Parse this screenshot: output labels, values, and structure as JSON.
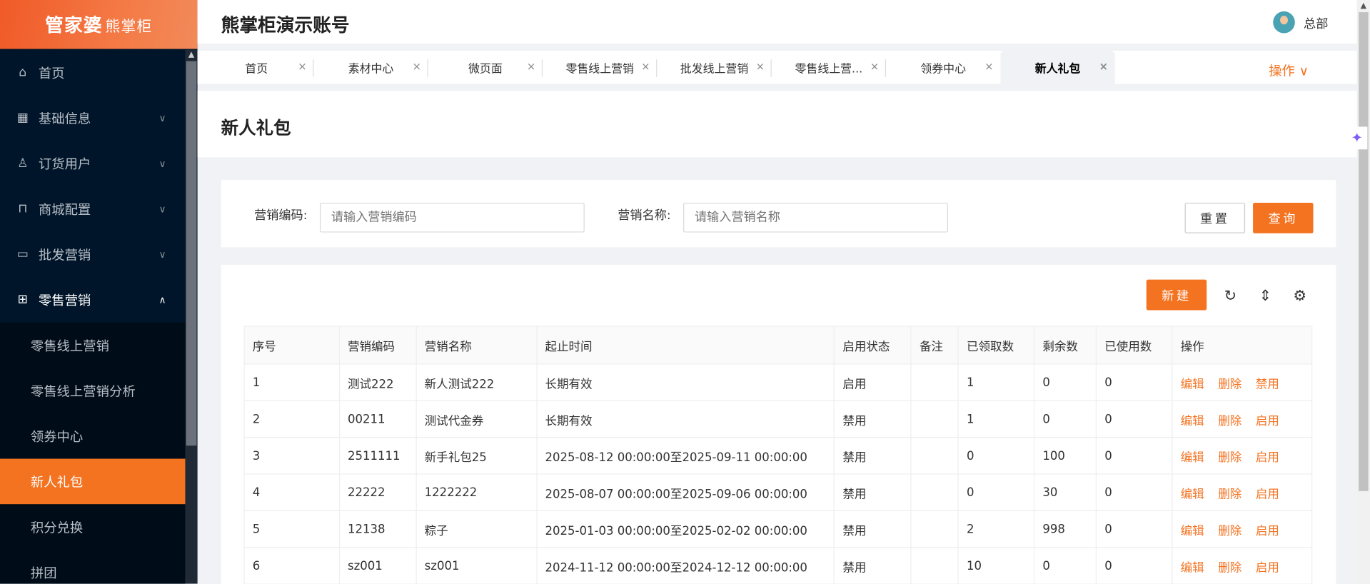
{
  "logo": {
    "brand": "管家婆",
    "sub": "熊掌柜"
  },
  "sidebar": {
    "items": [
      {
        "label": "首页",
        "icon": "home-icon",
        "glyph": "⌂"
      },
      {
        "label": "基础信息",
        "icon": "grid-icon",
        "glyph": "▦",
        "chev": "∨"
      },
      {
        "label": "订货用户",
        "icon": "users-icon",
        "glyph": "♙",
        "chev": "∨"
      },
      {
        "label": "商城配置",
        "icon": "bag-icon",
        "glyph": "⊓",
        "chev": "∨"
      },
      {
        "label": "批发营销",
        "icon": "card-icon",
        "glyph": "▭",
        "chev": "∨"
      },
      {
        "label": "零售营销",
        "icon": "gift-icon",
        "glyph": "⊞",
        "chev": "∧"
      }
    ],
    "sub": [
      "零售线上营销",
      "零售线上营销分析",
      "领券中心",
      "新人礼包",
      "积分兑换",
      "拼团"
    ]
  },
  "header": {
    "title": "熊掌柜演示账号",
    "user": "总部"
  },
  "tabs": [
    "首页",
    "素材中心",
    "微页面",
    "零售线上营销",
    "批发线上营销",
    "零售线上营...",
    "领券中心",
    "新人礼包"
  ],
  "tab_close": "×",
  "ops_label": "操作 ∨",
  "page_title": "新人礼包",
  "search": {
    "code_label": "营销编码:",
    "code_placeholder": "请输入营销编码",
    "name_label": "营销名称:",
    "name_placeholder": "请输入营销名称",
    "reset": "重置",
    "query": "查询"
  },
  "toolbar": {
    "new": "新建",
    "refresh": "↻",
    "density": "⇕",
    "settings": "⚙"
  },
  "table": {
    "headers": [
      "序号",
      "营销编码",
      "营销名称",
      "起止时间",
      "启用状态",
      "备注",
      "已领取数",
      "剩余数",
      "已使用数",
      "操作"
    ],
    "rows": [
      {
        "no": "1",
        "code": "测试222",
        "name": "新人测试222",
        "time": "长期有效",
        "status": "启用",
        "note": "",
        "got": "1",
        "left": "0",
        "used": "0",
        "a1": "编辑",
        "a2": "删除",
        "a3": "禁用"
      },
      {
        "no": "2",
        "code": "00211",
        "name": "测试代金券",
        "time": "长期有效",
        "status": "禁用",
        "note": "",
        "got": "1",
        "left": "0",
        "used": "0",
        "a1": "编辑",
        "a2": "删除",
        "a3": "启用"
      },
      {
        "no": "3",
        "code": "2511111",
        "name": "新手礼包25",
        "time": "2025-08-12 00:00:00至2025-09-11 00:00:00",
        "status": "禁用",
        "note": "",
        "got": "0",
        "left": "100",
        "used": "0",
        "a1": "编辑",
        "a2": "删除",
        "a3": "启用"
      },
      {
        "no": "4",
        "code": "22222",
        "name": "1222222",
        "time": "2025-08-07 00:00:00至2025-09-06 00:00:00",
        "status": "禁用",
        "note": "",
        "got": "0",
        "left": "30",
        "used": "0",
        "a1": "编辑",
        "a2": "删除",
        "a3": "启用"
      },
      {
        "no": "5",
        "code": "12138",
        "name": "粽子",
        "time": "2025-01-03 00:00:00至2025-02-02 00:00:00",
        "status": "禁用",
        "note": "",
        "got": "2",
        "left": "998",
        "used": "0",
        "a1": "编辑",
        "a2": "删除",
        "a3": "启用"
      },
      {
        "no": "6",
        "code": "sz001",
        "name": "sz001",
        "time": "2024-11-12 00:00:00至2024-12-12 00:00:00",
        "status": "禁用",
        "note": "",
        "got": "10",
        "left": "0",
        "used": "0",
        "a1": "编辑",
        "a2": "删除",
        "a3": "启用"
      }
    ]
  },
  "colors": {
    "accent": "#f47321",
    "sidebar": "#001529"
  }
}
